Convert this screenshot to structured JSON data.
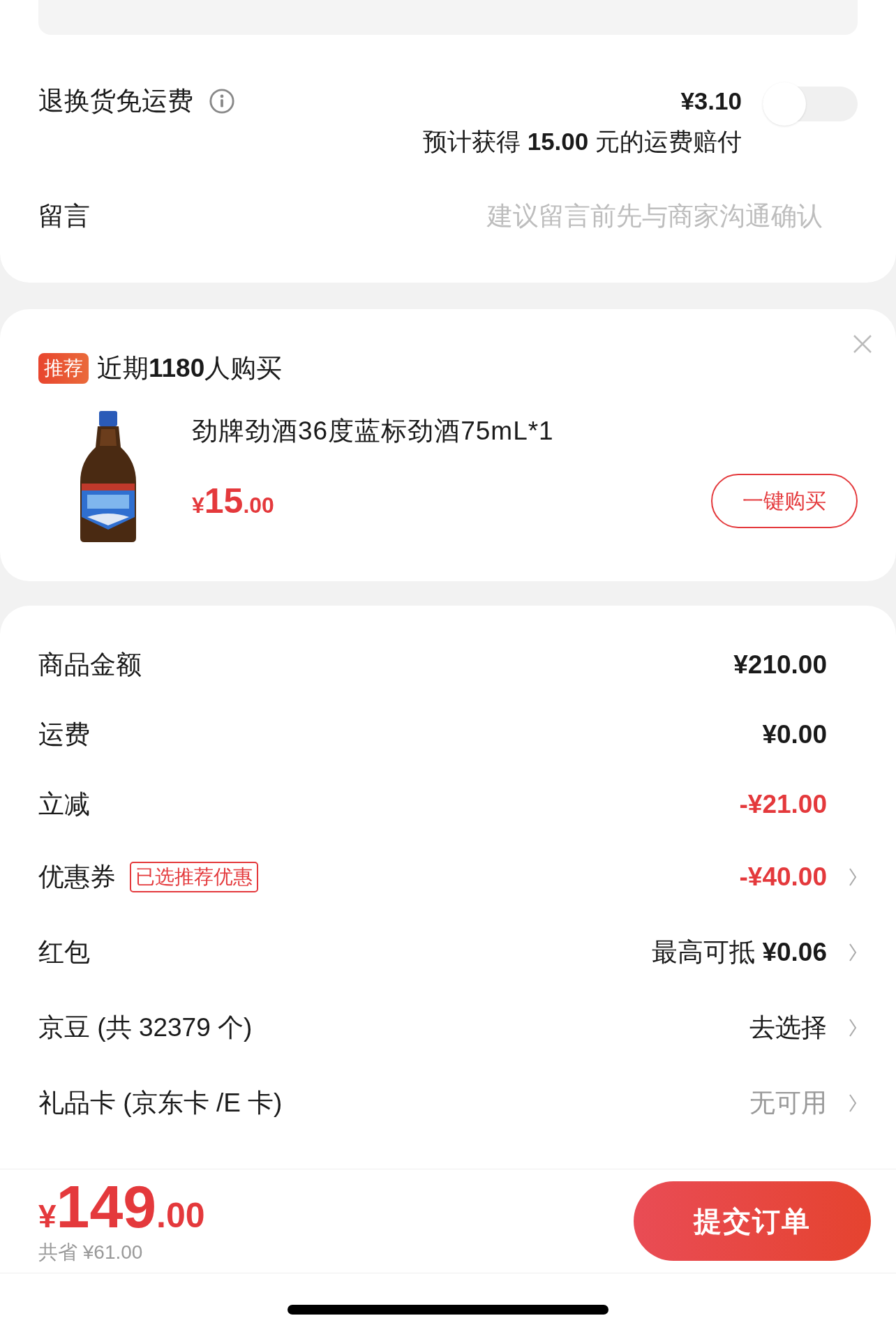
{
  "shipping_insurance": {
    "label": "退换货免运费",
    "price": "¥3.10",
    "note": "预计获得 **15.00** 元的运费赔付",
    "on": false
  },
  "message": {
    "label": "留言",
    "placeholder": "建议留言前先与商家沟通确认"
  },
  "recommendation": {
    "tag": "推荐",
    "headline": "近期**1180**人购买",
    "product": {
      "kind": "picture",
      "title": "劲牌劲酒36度蓝标劲酒75mL*1",
      "currency": "¥",
      "price_integer": "15",
      "price_decimal": ".00",
      "button": "一键购买"
    }
  },
  "summary": [
    {
      "kind": "amount",
      "label": "商品金额",
      "value": "¥210.00",
      "chevron": false
    },
    {
      "kind": "amount",
      "label": "运费",
      "value": "¥0.00",
      "chevron": false
    },
    {
      "kind": "discount",
      "label": "立减",
      "value": "-¥21.00",
      "chevron": false
    },
    {
      "kind": "discount",
      "label": "优惠券",
      "tag": "已选推荐优惠",
      "value": "-¥40.00",
      "chevron": true
    },
    {
      "kind": "option",
      "label": "红包",
      "value": "最高可抵 **¥0.06**",
      "chevron": true
    },
    {
      "kind": "option",
      "label": "京豆 (共 32379 个)",
      "value": "去选择",
      "chevron": true
    },
    {
      "kind": "unavailable",
      "label": "礼品卡 (京东卡 /E 卡)",
      "value": "无可用",
      "chevron": true
    }
  ],
  "footer": {
    "currency": "¥",
    "total_integer": "149",
    "total_decimal": ".00",
    "savings": "共省 ¥61.00",
    "submit": "提交订单"
  }
}
